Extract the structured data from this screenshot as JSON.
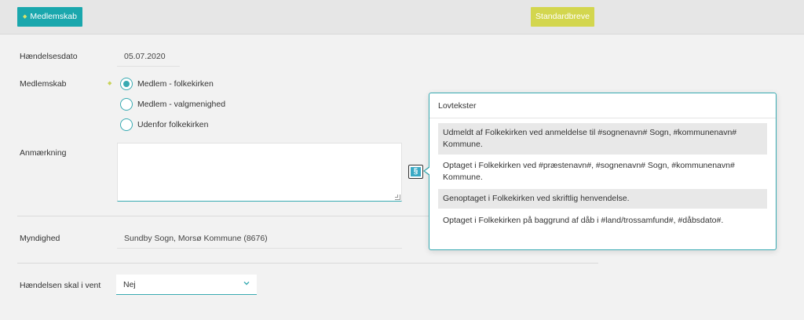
{
  "toolbar": {
    "medlemskab_label": "Medlemskab",
    "standardbreve_label": "Standardbreve"
  },
  "form": {
    "haendelsesdato": {
      "label": "Hændelsesdato",
      "value": "05.07.2020"
    },
    "medlemskab": {
      "label": "Medlemskab",
      "options": [
        {
          "label": "Medlem - folkekirken",
          "selected": true
        },
        {
          "label": "Medlem - valgmenighed",
          "selected": false
        },
        {
          "label": "Udenfor folkekirken",
          "selected": false
        }
      ]
    },
    "anmaerkning": {
      "label": "Anmærkning",
      "value": ""
    },
    "paragraph_icon": "§",
    "myndighed": {
      "label": "Myndighed",
      "value": "Sundby Sogn, Morsø Kommune (8676)"
    },
    "vent": {
      "label": "Hændelsen skal i vent",
      "selected": "Nej"
    }
  },
  "lovtekster": {
    "title": "Lovtekster",
    "items": [
      "Udmeldt af Folkekirken ved anmeldelse til #sognenavn# Sogn, #kommunenavn# Kommune.",
      "Optaget i Folkekirken ved #præstenavn#, #sognenavn# Sogn, #kommunenavn# Kommune.",
      "Genoptaget i Folkekirken ved skriftlig henvendelse.",
      "Optaget i Folkekirken på baggrund af dåb i #land/trossamfund#, #dåbsdato#."
    ]
  },
  "colors": {
    "accent": "#1aa7ad",
    "standardbreve": "#d3d64e",
    "border_accent": "#38aab2"
  },
  "icons": {
    "required_marker": "diamond-icon",
    "dropdown": "chevron-down-icon",
    "resize": "resize-grip-icon",
    "paragraph": "paragraph-icon"
  }
}
